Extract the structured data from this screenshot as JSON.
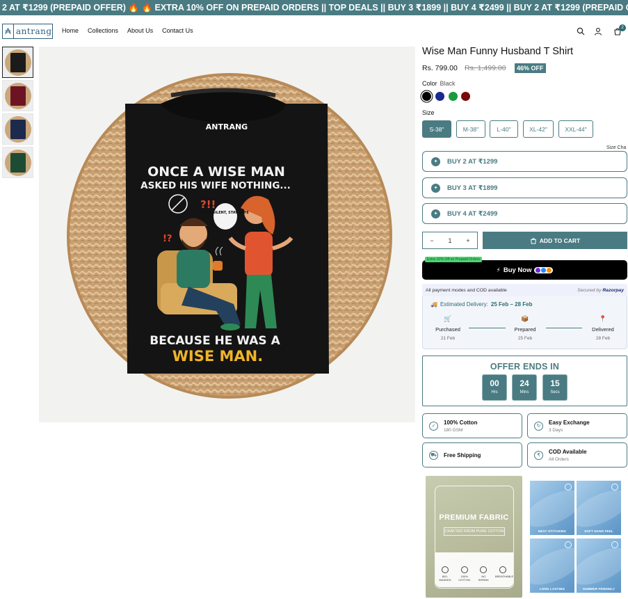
{
  "announcement": "2 AT ₹1299 (PREPAID OFFER) 🔥 🔥 EXTRA 10% OFF ON PREPAID ORDERS || TOP DEALS || BUY 3 ₹1899 || BUY 4 ₹2499 || BUY 2 AT ₹1299 (PREPAID OFFER) 🔥",
  "brand": {
    "logo_text": "antrang",
    "logo_mark": "₳"
  },
  "nav": [
    "Home",
    "Collections",
    "About Us",
    "Contact Us"
  ],
  "cart_count": "2",
  "gallery": {
    "thumb_colors": [
      "#1b1b1b",
      "#6c1424",
      "#1c2a4d",
      "#1e4b33"
    ],
    "active_index": 0,
    "shirt": {
      "brand_print": "ANTRANG",
      "line1": "ONCE A WISE MAN",
      "line2": "ASKED HIS WIFE NOTHING...",
      "bubble": "STAY SILENT, STAY SAFE",
      "exclaim": "?!!",
      "question": "!?",
      "line3": "BECAUSE HE WAS A",
      "line4": "WISE MAN."
    }
  },
  "product": {
    "title": "Wise Man Funny Husband T Shirt",
    "price": "Rs. 799.00",
    "mrp": "Rs. 1,499.00",
    "discount": "46% OFF",
    "color_label": "Color",
    "color_value": "Black",
    "swatches": [
      "#000000",
      "#1c2a8c",
      "#1a9c3d",
      "#7a0a0a"
    ],
    "size_label": "Size",
    "sizes": [
      "S-38\"",
      "M-38\"",
      "L-40\"",
      "XL-42\"",
      "XXL-44\""
    ],
    "selected_size": "S-38\"",
    "size_chart": "Size Cha"
  },
  "offers": [
    "BUY 2 AT ₹1299",
    "BUY 3 AT ₹1899",
    "BUY 4 AT ₹2499"
  ],
  "quantity": {
    "value": "1",
    "minus": "−",
    "plus": "+"
  },
  "add_to_cart": "ADD TO CART",
  "promo_chip": "Extra 10% Off on Prepaid Orders",
  "buy_now": "Buy Now",
  "payment_info": {
    "left": "All payment modes and COD available",
    "secured": "Secured by",
    "provider": "Razorpay"
  },
  "delivery": {
    "label": "Estimated Delivery:",
    "range": "25 Feb – 28 Feb",
    "steps": [
      {
        "label": "Purchased",
        "date": "21 Feb",
        "icon": "🛒"
      },
      {
        "label": "Prepared",
        "date": "25 Feb",
        "icon": "📦"
      },
      {
        "label": "Delivered",
        "date": "28 Feb",
        "icon": "📍"
      }
    ]
  },
  "countdown": {
    "title": "OFFER ENDS IN",
    "units": [
      {
        "value": "00",
        "label": "Hrs"
      },
      {
        "value": "24",
        "label": "Mins"
      },
      {
        "value": "15",
        "label": "Secs"
      }
    ]
  },
  "features": [
    {
      "title": "100% Cotton",
      "sub": "180 GSM",
      "icon": "✓"
    },
    {
      "title": "Easy Exchange",
      "sub": "3 Days",
      "icon": "↻"
    },
    {
      "title": "Free Shipping",
      "sub": "",
      "icon": "⛟"
    },
    {
      "title": "COD Available",
      "sub": "All Orders",
      "icon": "₹"
    }
  ],
  "fabric_card": {
    "title": "PREMIUM FABRIC",
    "subtitle": "CRAFTED FROM PURE COTTON",
    "icons": [
      "BIO-WASHED",
      "100% COTTON",
      "NO SHRINK",
      "BREATHABLE"
    ]
  },
  "feature_tiles": [
    "NEAT STITCHING",
    "SOFT HAND FEEL",
    "LONG LASTING",
    "SUMMER FRIENDLY"
  ],
  "colors": {
    "accent": "#4a7b82",
    "announcement_bg": "#4a7b82"
  }
}
